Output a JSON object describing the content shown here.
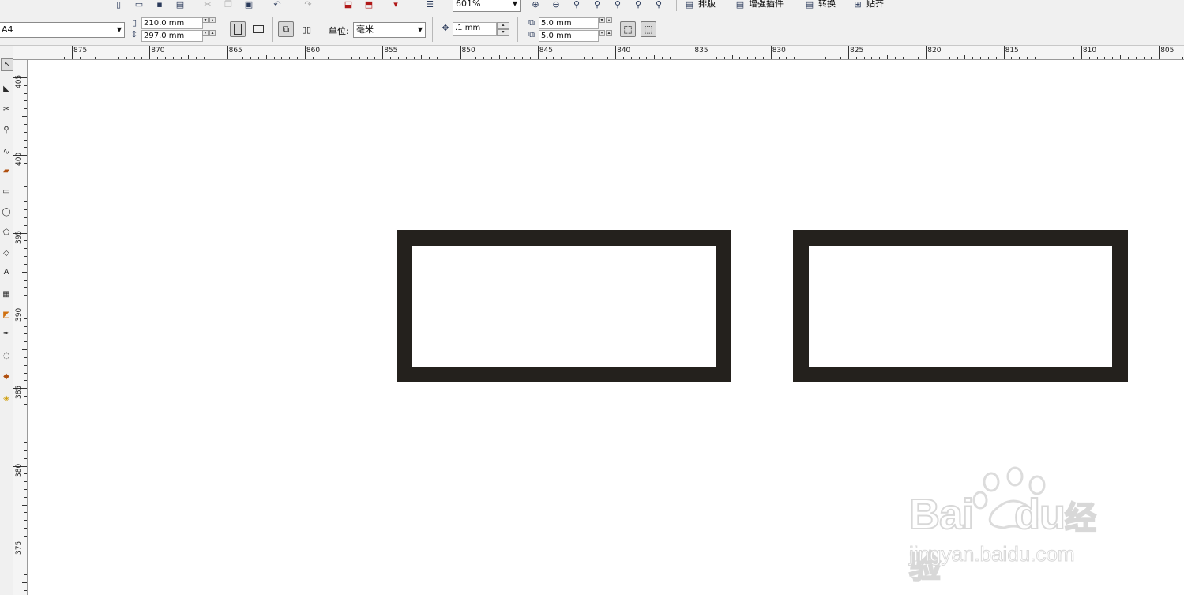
{
  "toolbar_top": {
    "zoom_value": "601%",
    "menus": [
      {
        "label": "排版"
      },
      {
        "label": "增强插件"
      },
      {
        "label": "转换"
      },
      {
        "label": "贴齐"
      }
    ]
  },
  "property_bar": {
    "paper_size": "A4",
    "width_value": "210.0 mm",
    "height_value": "297.0 mm",
    "unit_label": "单位:",
    "unit_value": "毫米",
    "nudge_value": ".1 mm",
    "dup_x_value": "5.0 mm",
    "dup_y_value": "5.0 mm"
  },
  "ruler": {
    "corner": "⌖",
    "h_ticks": [
      "875",
      "870",
      "865",
      "860",
      "855",
      "850",
      "845",
      "840",
      "835",
      "830",
      "825",
      "820",
      "815",
      "810",
      "805"
    ],
    "v_ticks": [
      "405",
      "400",
      "395",
      "390",
      "385",
      "380",
      "375"
    ]
  },
  "watermark": {
    "brand": "Bai",
    "brand2": "du",
    "suffix": "经验",
    "url": "jingyan.baidu.com"
  },
  "colors": {
    "shape_outline": "#24211d",
    "chrome": "#f0f0f0",
    "watermark": "#dcdcdc"
  },
  "icons": [
    "new-doc-icon",
    "open-icon",
    "save-icon",
    "print-icon",
    "cut-icon",
    "copy-icon",
    "paste-icon",
    "undo-icon",
    "redo-icon",
    "import-icon",
    "export-icon",
    "publish-icon",
    "app-launcher-icon",
    "zoom-in-icon",
    "zoom-out-icon"
  ]
}
